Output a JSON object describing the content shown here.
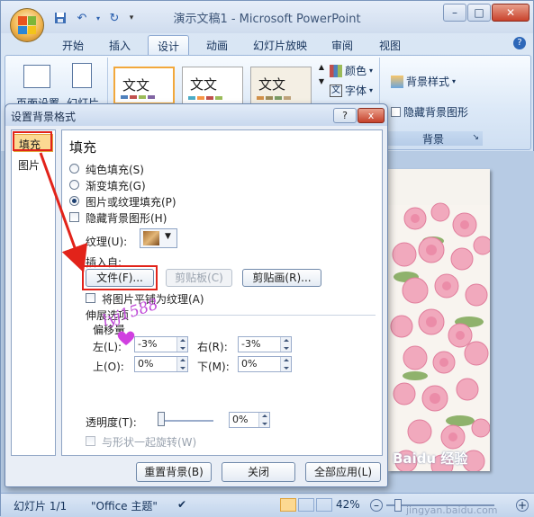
{
  "app": {
    "title": "演示文稿1 - Microsoft PowerPoint",
    "tabs": [
      "开始",
      "插入",
      "设计",
      "动画",
      "幻灯片放映",
      "审阅",
      "视图"
    ],
    "active_tab": "设计"
  },
  "ribbon": {
    "page_setup_label": "页面设置",
    "slide_dir_label": "幻灯片",
    "theme_thumb_text": "文文",
    "colors_label": "颜色",
    "fonts_label": "字体",
    "bg_styles_label": "背景样式",
    "hide_bg_label": "隐藏背景图形",
    "bg_group_label": "背景"
  },
  "dialog": {
    "title": "设置背景格式",
    "help_label": "?",
    "close_label": "x",
    "categories": [
      "填充",
      "图片"
    ],
    "selected_category": "填充",
    "heading": "填充",
    "fill_options": [
      {
        "label": "纯色填充(S)",
        "checked": false
      },
      {
        "label": "渐变填充(G)",
        "checked": false
      },
      {
        "label": "图片或纹理填充(P)",
        "checked": true
      }
    ],
    "hide_bg_graphics": "隐藏背景图形(H)",
    "texture_label": "纹理(U):",
    "insert_from_label": "插入自:",
    "file_button": "文件(F)...",
    "clipboard_button": "剪贴板(C)",
    "clipart_button": "剪贴画(R)...",
    "tile_checkbox": "将图片平铺为纹理(A)",
    "stretch_label": "伸展选项",
    "offset_label": "偏移量",
    "left_label": "左(L):",
    "left_value": "-3%",
    "right_label": "右(R):",
    "right_value": "-3%",
    "top_label": "上(O):",
    "top_value": "0%",
    "bottom_label": "下(M):",
    "bottom_value": "0%",
    "transparency_label": "透明度(T):",
    "transparency_value": "0%",
    "rotate_with_shape": "与形状一起旋转(W)",
    "reset_button": "重置背景(B)",
    "close_button": "关闭",
    "apply_all_button": "全部应用(L)"
  },
  "watermark": {
    "handwriting": "lyj1588",
    "brand": "Baidu 经验",
    "url": "jingyan.baidu.com"
  },
  "status": {
    "slide_info": "幻灯片 1/1",
    "theme": "\"Office 主题\"",
    "zoom": "42%"
  },
  "colors": {
    "accent_red": "#e2231a",
    "selected_orange": "#f2a83c"
  }
}
